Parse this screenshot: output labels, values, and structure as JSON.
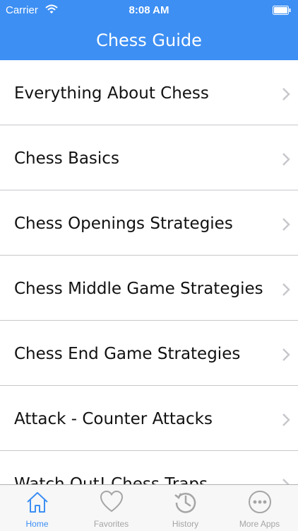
{
  "status_bar": {
    "carrier": "Carrier",
    "time": "8:08 AM"
  },
  "header": {
    "title": "Chess Guide"
  },
  "list": {
    "items": [
      {
        "label": "Everything About Chess"
      },
      {
        "label": "Chess Basics"
      },
      {
        "label": "Chess Openings Strategies"
      },
      {
        "label": "Chess Middle Game Strategies"
      },
      {
        "label": "Chess End Game Strategies"
      },
      {
        "label": "Attack - Counter Attacks"
      },
      {
        "label": "Watch  Out! Chess Traps"
      }
    ]
  },
  "tabbar": {
    "tabs": [
      {
        "label": "Home",
        "icon": "home-icon",
        "active": true
      },
      {
        "label": "Favorites",
        "icon": "heart-icon",
        "active": false
      },
      {
        "label": "History",
        "icon": "history-icon",
        "active": false
      },
      {
        "label": "More Apps",
        "icon": "more-icon",
        "active": false
      }
    ]
  },
  "colors": {
    "accent": "#3d8ff3",
    "inactive": "#a5a5a5"
  }
}
